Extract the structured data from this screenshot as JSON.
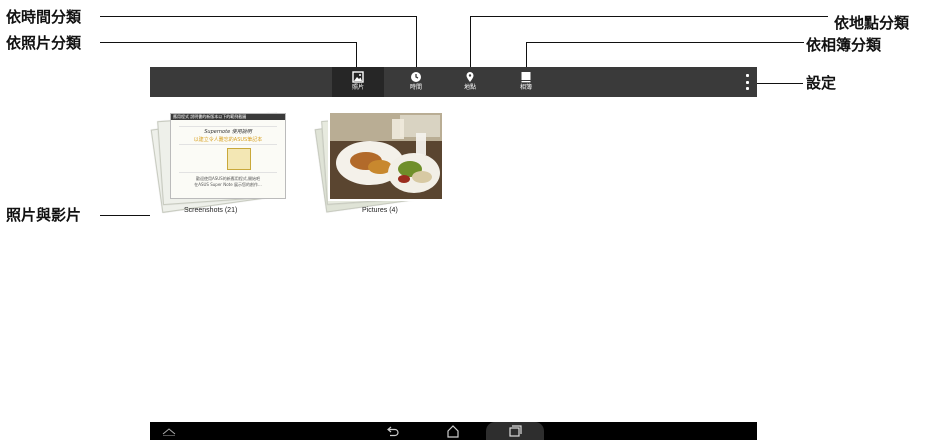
{
  "callouts": {
    "by_time": "依時間分類",
    "by_photo": "依照片分類",
    "by_location": "依地點分類",
    "by_album": "依相簿分類",
    "settings": "設定",
    "photos_videos": "照片與影片"
  },
  "actionbar": {
    "tabs": [
      {
        "label": "照片",
        "icon": "photo-icon",
        "selected": true
      },
      {
        "label": "時間",
        "icon": "clock-icon",
        "selected": false
      },
      {
        "label": "地點",
        "icon": "location-pin-icon",
        "selected": false
      },
      {
        "label": "相簿",
        "icon": "album-icon",
        "selected": false
      }
    ],
    "overflow_icon": "overflow-menu-icon"
  },
  "albums": [
    {
      "label": "Screenshots (21)",
      "thumbnail": {
        "header": "應用程式  說明書的新版本以下的範例截圖",
        "title": "Supernote 使用說明",
        "subtitle": "以建立令人難忘的ASUS筆記本",
        "line1": "歡迎使用ASUS的新應用程式,開始吧",
        "line2": "在ASUS Super Note 展示您的創作..."
      }
    },
    {
      "label": "Pictures (4)"
    }
  ],
  "navbar": {
    "icons": [
      "collapse-icon",
      "back-icon",
      "home-icon",
      "recent-apps-icon"
    ]
  },
  "colors": {
    "actionbar": "#3a3a3a",
    "tab_selected": "#262626",
    "callout_dot": "#0a86c9",
    "navbar": "#000000"
  }
}
